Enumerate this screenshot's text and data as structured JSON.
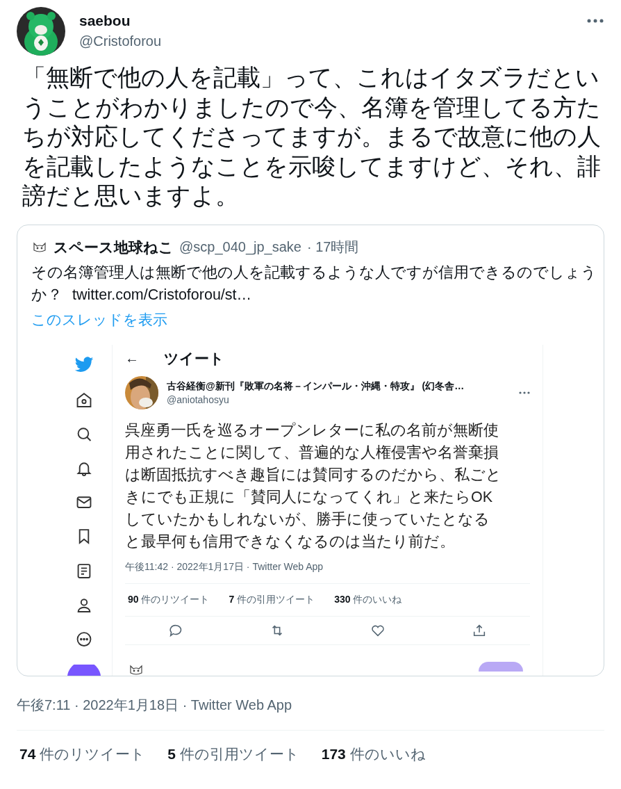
{
  "author": {
    "name": "saebou",
    "handle": "@Cristoforou"
  },
  "body": "「無断で他の人を記載」って、これはイタズラだということがわかりましたので今、名簿を管理してる方たちが対応してくださってますが。まるで故意に他の人を記載したようなことを示唆してますけど、それ、誹謗だと思いますよ。",
  "quoted_tweet": {
    "name": "スペース地球ねこ",
    "handle": "@scp_040_jp_sake",
    "time": "· 17時間",
    "text": "その名簿管理人は無断で他の人を記載するような人ですが信用できるのでしょうか？",
    "link": "twitter.com/Cristoforou/st…",
    "thread_link": "このスレッドを表示",
    "screenshot": {
      "header": {
        "back": "←",
        "title": "ツイート"
      },
      "author": {
        "name": "古谷経衡@新刊『敗軍の名将－インパール・沖縄・特攻』 (幻冬舎…",
        "handle": "@aniotahosyu"
      },
      "text": "呉座勇一氏を巡るオープンレターに私の名前が無断使用されたことに関して、普遍的な人権侵害や名誉棄損は断固抵抗すべき趣旨には賛同するのだから、私ごときにでも正規に「賛同人になってくれ」と来たらOKしていたかもしれないが、勝手に使っていたとなると最早何も信用できなくなるのは当たり前だ。",
      "timestamp": "午後11:42 · 2022年1月17日 · Twitter Web App",
      "stats": [
        {
          "count": "90",
          "label": "件のリツイート"
        },
        {
          "count": "7",
          "label": "件の引用ツイート"
        },
        {
          "count": "330",
          "label": "件のいいね"
        }
      ]
    }
  },
  "timestamp": "午後7:11 · 2022年1月18日 · Twitter Web App",
  "stats": [
    {
      "count": "74",
      "label": "件のリツイート"
    },
    {
      "count": "5",
      "label": "件の引用ツイート"
    },
    {
      "count": "173",
      "label": "件のいいね"
    }
  ]
}
